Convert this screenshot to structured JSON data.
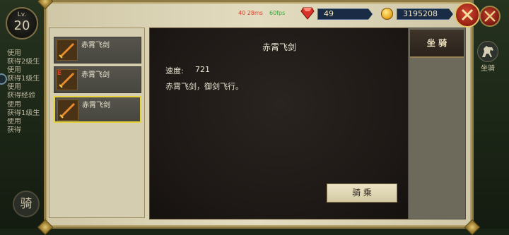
{
  "level": {
    "label": "Lv.",
    "value": "20"
  },
  "chat_log": [
    {
      "action": "使用",
      "item": ""
    },
    {
      "action": "获得",
      "item": "2级生"
    },
    {
      "action": "使用",
      "item": ""
    },
    {
      "action": "获得",
      "item": "1级生"
    },
    {
      "action": "使用",
      "item": ""
    },
    {
      "action": "获得",
      "item": "经验"
    },
    {
      "action": "使用",
      "item": ""
    },
    {
      "action": "获得",
      "item": "1级生"
    },
    {
      "action": "使用",
      "item": ""
    },
    {
      "action": "获得",
      "item": ""
    }
  ],
  "left_ride_button": "骑",
  "top_bar": {
    "ping": "40 28ms",
    "fps": "60fps",
    "gems": "49",
    "gold": "3195208"
  },
  "mount_list": [
    {
      "name": "赤霄飞剑",
      "equipped_mark": ""
    },
    {
      "name": "赤霄飞剑",
      "equipped_mark": "E"
    },
    {
      "name": "赤霄飞剑",
      "equipped_mark": ""
    }
  ],
  "detail": {
    "title": "赤霄飞剑",
    "speed_label": "速度:",
    "speed_value": "721",
    "description": "赤霄飞剑，御剑飞行。",
    "ride_button": "骑 乘"
  },
  "tabs": {
    "mount": "坐 骑"
  },
  "side_menu": {
    "mount_label": "坐骑"
  },
  "colors": {
    "panel": "#e3dcc0",
    "detail_bg": "#1d1815",
    "selected_border": "#e6d23a",
    "close_red": "#c23e2b"
  }
}
